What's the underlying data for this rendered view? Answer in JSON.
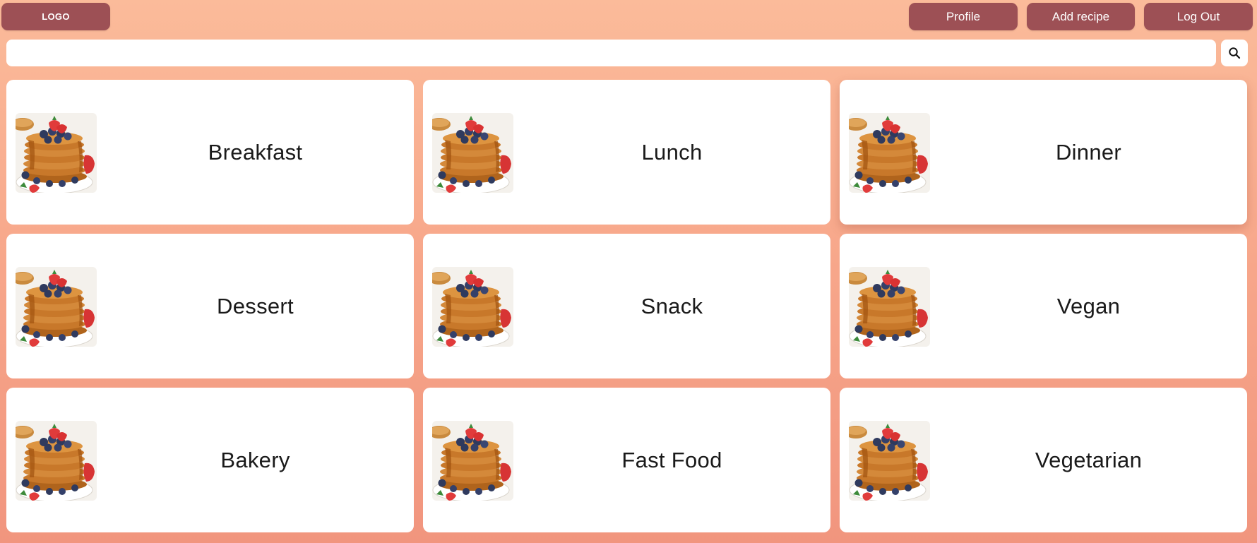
{
  "header": {
    "logo_label": "LOGO",
    "nav": {
      "profile_label": "Profile",
      "add_recipe_label": "Add recipe",
      "logout_label": "Log Out"
    }
  },
  "search": {
    "value": "",
    "placeholder": "",
    "button_icon": "search-icon"
  },
  "categories": [
    {
      "label": "Breakfast",
      "image": "pancake-stack-photo"
    },
    {
      "label": "Lunch",
      "image": "pancake-stack-photo"
    },
    {
      "label": "Dinner",
      "image": "pancake-stack-photo"
    },
    {
      "label": "Dessert",
      "image": "pancake-stack-photo"
    },
    {
      "label": "Snack",
      "image": "pancake-stack-photo"
    },
    {
      "label": "Vegan",
      "image": "pancake-stack-photo"
    },
    {
      "label": "Bakery",
      "image": "pancake-stack-photo"
    },
    {
      "label": "Fast Food",
      "image": "pancake-stack-photo"
    },
    {
      "label": "Vegetarian",
      "image": "pancake-stack-photo"
    }
  ],
  "colors": {
    "background_top": "#fbbb9a",
    "background_bottom": "#f1957e",
    "button": "#9d5055",
    "card": "#ffffff"
  }
}
